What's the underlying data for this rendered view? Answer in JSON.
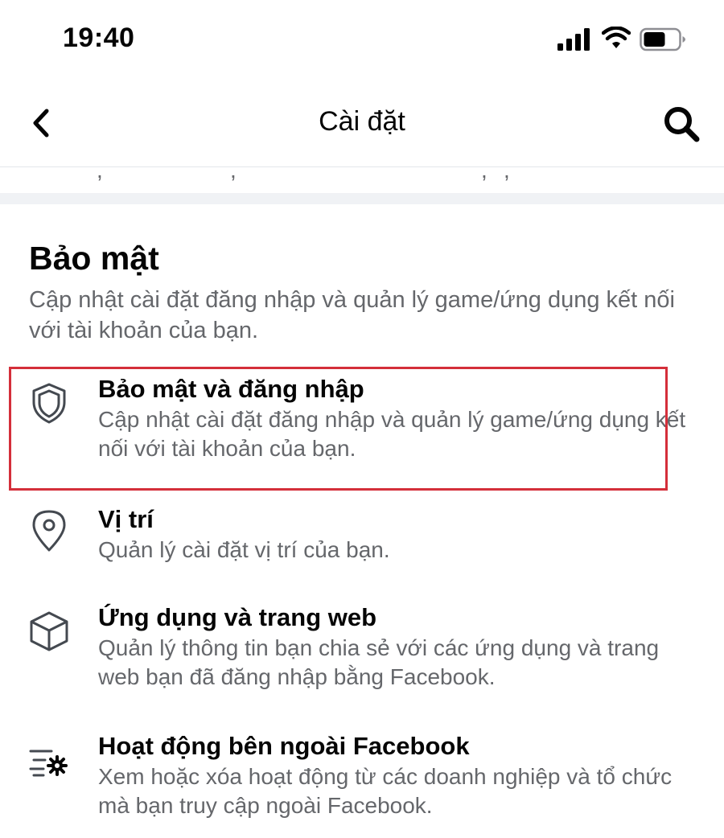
{
  "status_bar": {
    "time": "19:40"
  },
  "nav": {
    "title": "Cài đặt",
    "back_icon": "chevron-left-icon",
    "search_icon": "search-icon"
  },
  "section": {
    "title": "Bảo mật",
    "description": "Cập nhật cài đặt đăng nhập và quản lý game/ứng dụng kết nối với tài khoản của bạn."
  },
  "items": [
    {
      "icon": "shield-icon",
      "title": "Bảo mật và đăng nhập",
      "description": "Cập nhật cài đặt đăng nhập và quản lý game/ứng dụng kết nối với tài khoản của bạn.",
      "highlighted": true
    },
    {
      "icon": "location-pin-icon",
      "title": "Vị trí",
      "description": "Quản lý cài đặt vị trí của bạn."
    },
    {
      "icon": "cube-icon",
      "title": "Ứng dụng và trang web",
      "description": "Quản lý thông tin bạn chia sẻ với các ứng dụng và trang web bạn đã đăng nhập bằng Facebook."
    },
    {
      "icon": "activity-settings-icon",
      "title": "Hoạt động bên ngoài Facebook",
      "description": "Xem hoặc xóa hoạt động từ các doanh nghiệp và tổ chức mà bạn truy cập ngoài Facebook."
    }
  ],
  "colors": {
    "highlight": "#d42f3a",
    "secondary_text": "#65676b",
    "divider": "#f0f2f5"
  }
}
